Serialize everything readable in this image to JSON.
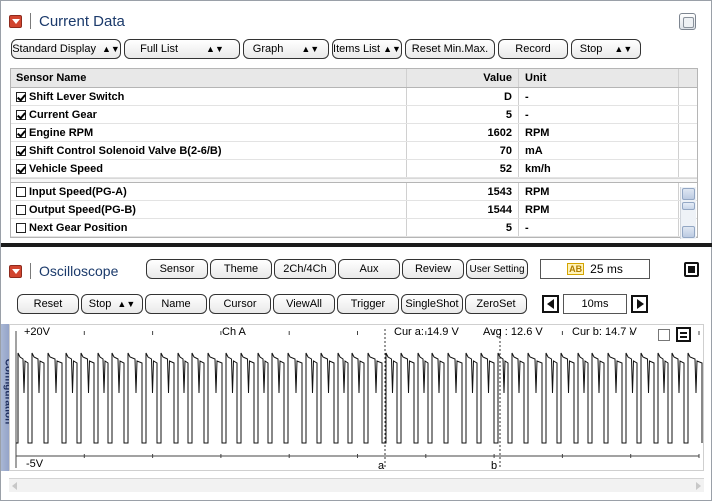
{
  "current_data": {
    "title": "Current Data",
    "toolbar": [
      {
        "label": "Standard Display",
        "dropdown": true
      },
      {
        "label": "Full List",
        "dropdown": true
      },
      {
        "label": "Graph",
        "dropdown": true
      },
      {
        "label": "Items List",
        "dropdown": true
      },
      {
        "label": "Reset Min.Max.",
        "dropdown": false
      },
      {
        "label": "Record",
        "dropdown": false
      },
      {
        "label": "Stop",
        "dropdown": true
      }
    ],
    "columns": {
      "name": "Sensor Name",
      "value": "Value",
      "unit": "Unit"
    },
    "checked_rows": [
      {
        "name": "Shift Lever Switch",
        "value": "D",
        "unit": "-",
        "checked": true
      },
      {
        "name": "Current Gear",
        "value": "5",
        "unit": "-",
        "checked": true
      },
      {
        "name": "Engine RPM",
        "value": "1602",
        "unit": "RPM",
        "checked": true
      },
      {
        "name": "Shift Control Solenoid Valve B(2-6/B)",
        "value": "70",
        "unit": "mA",
        "checked": true
      },
      {
        "name": "Vehicle Speed",
        "value": "52",
        "unit": "km/h",
        "checked": true
      }
    ],
    "unchecked_rows": [
      {
        "name": "Input Speed(PG-A)",
        "value": "1543",
        "unit": "RPM",
        "checked": false
      },
      {
        "name": "Output Speed(PG-B)",
        "value": "1544",
        "unit": "RPM",
        "checked": false
      },
      {
        "name": "Next Gear Position",
        "value": "5",
        "unit": "-",
        "checked": false
      }
    ]
  },
  "oscilloscope": {
    "title": "Oscilloscope",
    "tabs": [
      "Sensor",
      "Theme",
      "2Ch/4Ch",
      "Aux",
      "Review",
      "User Setting"
    ],
    "time_display": "25 ms",
    "time_icon": "ab-icon",
    "controls": [
      {
        "label": "Reset",
        "dropdown": false
      },
      {
        "label": "Stop",
        "dropdown": true
      },
      {
        "label": "Name",
        "dropdown": false
      },
      {
        "label": "Cursor",
        "dropdown": false
      },
      {
        "label": "ViewAll",
        "dropdown": false
      },
      {
        "label": "Trigger",
        "dropdown": false
      },
      {
        "label": "SingleShot",
        "dropdown": false
      },
      {
        "label": "ZeroSet",
        "dropdown": false
      }
    ],
    "timebase": "10ms",
    "scope": {
      "top_label": "+20V",
      "bottom_label": "-5V",
      "channel": "Ch A",
      "cur_a": "Cur a: 14.9 V",
      "avg": "Avg  : 12.6 V",
      "cur_b": "Cur b: 14.7 V",
      "cursor_a": "a",
      "cursor_b": "b"
    },
    "side_tab": "Configuration"
  }
}
